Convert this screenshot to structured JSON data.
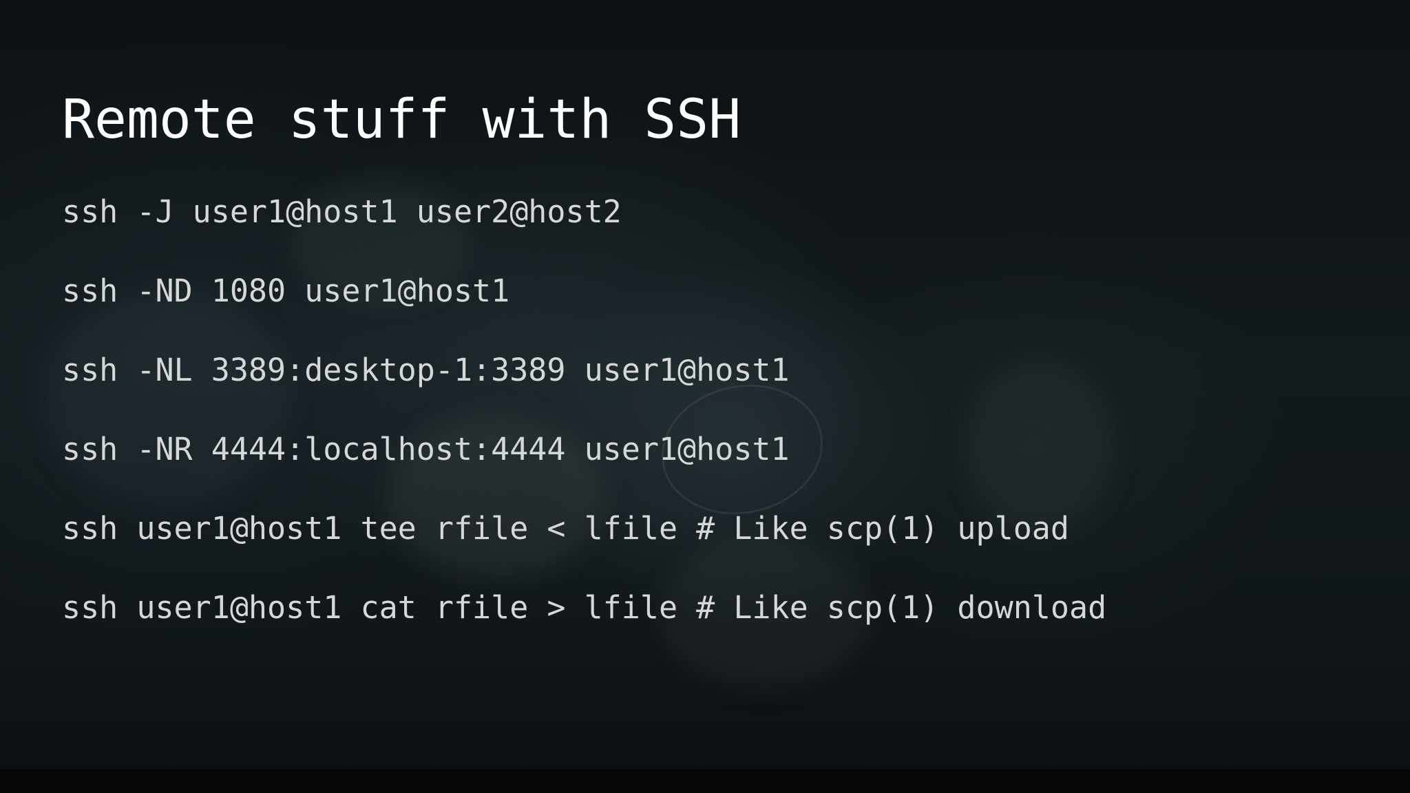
{
  "slide": {
    "title": "Remote stuff with SSH",
    "commands": [
      "ssh -J user1@host1 user2@host2",
      "ssh -ND 1080 user1@host1",
      "ssh -NL 3389:desktop-1:3389 user1@host1",
      "ssh -NR 4444:localhost:4444 user1@host1",
      "ssh user1@host1 tee rfile < lfile # Like scp(1) upload",
      "ssh user1@host1 cat rfile > lfile # Like scp(1) download"
    ]
  },
  "colors": {
    "background": "#0c1013",
    "title_text": "#ffffff",
    "body_text": "#d6d8d8"
  }
}
